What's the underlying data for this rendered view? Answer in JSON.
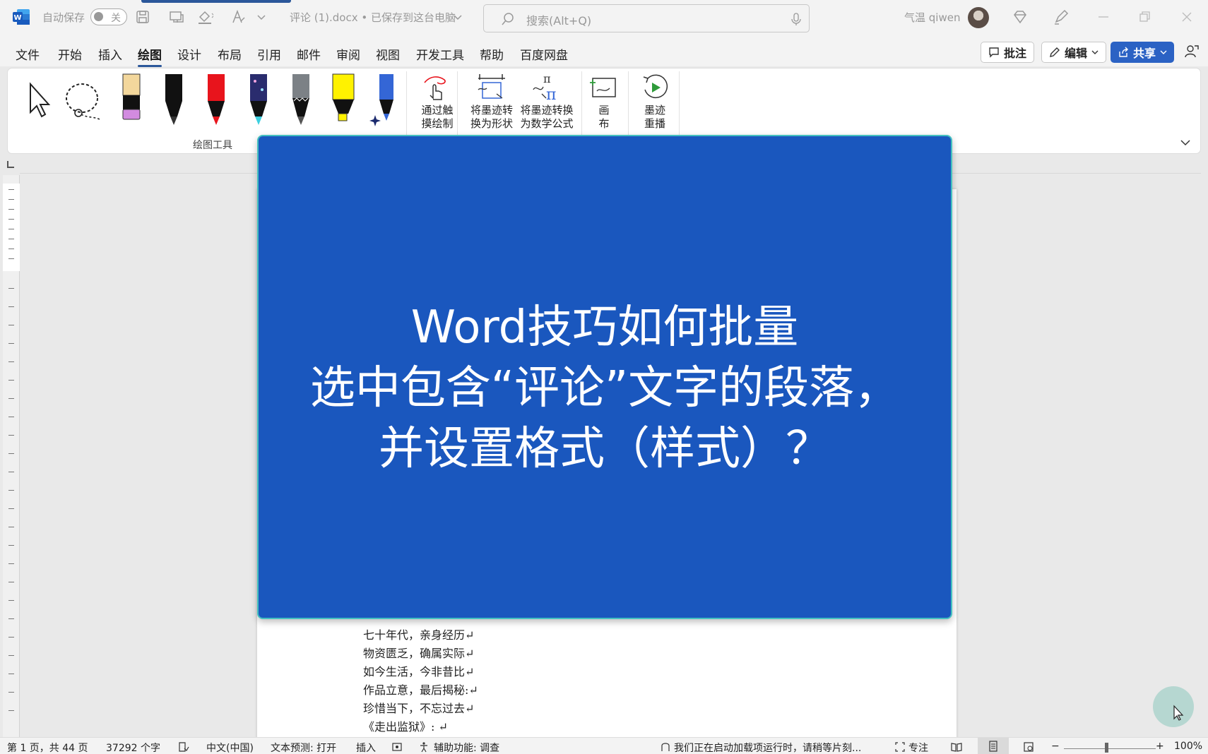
{
  "titlebar": {
    "autosave_label": "自动保存",
    "autosave_state": "关",
    "doc_title": "评论 (1).docx • 已保存到这台电脑",
    "search_placeholder": "搜索(Alt+Q)",
    "user_name": "气温 qiwen"
  },
  "menu": {
    "tabs": [
      "文件",
      "开始",
      "插入",
      "绘图",
      "设计",
      "布局",
      "引用",
      "邮件",
      "审阅",
      "视图",
      "开发工具",
      "帮助",
      "百度网盘"
    ],
    "active_tab": "绘图",
    "comment_button": "批注",
    "edit_button": "编辑",
    "share_button": "共享"
  },
  "ribbon": {
    "group_label": "绘图工具",
    "touch_draw": [
      "通过触",
      "摸绘制"
    ],
    "ink_to_shape": [
      "将墨迹转",
      "换为形状"
    ],
    "ink_to_math": [
      "将墨迹转换",
      "为数学公式"
    ],
    "canvas": [
      "画",
      "布"
    ],
    "ink_replay": [
      "墨迹",
      "重播"
    ]
  },
  "overlay": {
    "lines": [
      "Word技巧如何批量",
      "选中包含“评论”文字的段落，",
      "并设置格式（样式）？"
    ],
    "color": "#1a57be"
  },
  "document": {
    "lines": [
      "七十年代，亲身经历↵",
      "物资匮乏，确属实际↵",
      "如今生活，今非昔比↵",
      "作品立意，最后揭秘:↵",
      "珍惜当下，不忘过去↵",
      "《走出监狱》: ↵"
    ]
  },
  "statusbar": {
    "page": "第 1 页，共 44 页",
    "words": "37292 个字",
    "language": "中文(中国)",
    "text_predict": "文本预测: 打开",
    "insert_mode": "插入",
    "accessibility": "辅助功能: 调查",
    "addin_msg": "我们正在启动加载项运行时，请稍等片刻...",
    "focus": "专注",
    "zoom": "100%"
  },
  "colors": {
    "accent": "#2b579a",
    "share_button": "#2b62c4"
  }
}
